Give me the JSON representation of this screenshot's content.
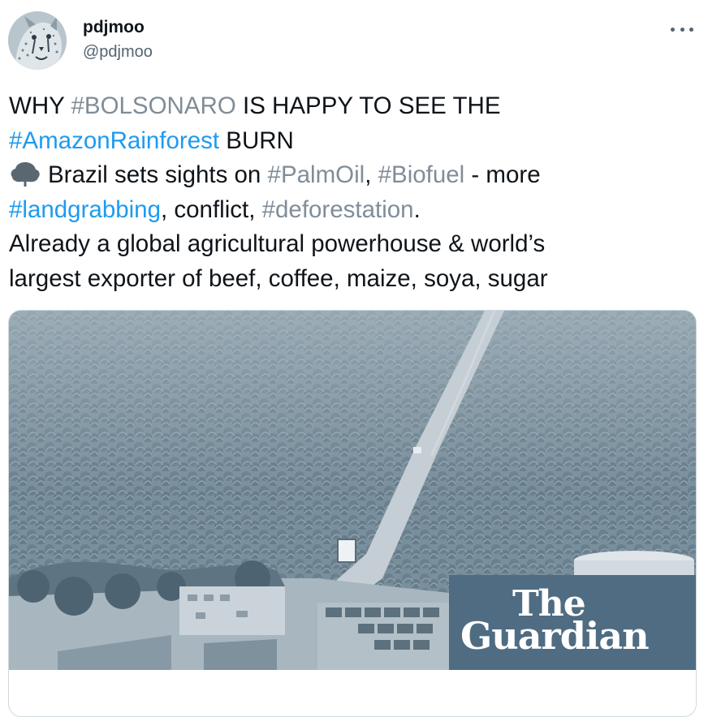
{
  "user": {
    "display_name": "pdjmoo",
    "handle": "@pdjmoo"
  },
  "tweet": {
    "line1": {
      "prefix": "WHY ",
      "hashtag": "#BOLSONARO",
      "suffix": " IS HAPPY TO SEE THE"
    },
    "line2": {
      "hashtag": "#AmazonRainforest",
      "suffix": " BURN"
    },
    "line3": {
      "text": "Brazil sets sights on ",
      "hashtag1": "#PalmOil",
      "sep": ", ",
      "hashtag2": "#Biofuel",
      "suffix": " - more"
    },
    "line4": {
      "hashtag1": "#landgrabbing",
      "mid": ", conflict, ",
      "hashtag2": "#deforestation",
      "suffix": "."
    },
    "line5": "Already a global agricultural powerhouse & world’s",
    "line6": "largest exporter of beef, coffee, maize, soya, sugar"
  },
  "card": {
    "logo_line1": "The",
    "logo_line2": "Guardian"
  },
  "icons": {
    "more": "more-horizontal-icon",
    "tree": "deciduous-tree-icon"
  },
  "colors": {
    "hashtag_blue": "#1d9bf0",
    "hashtag_gray": "#808d98",
    "guardian_panel": "#4f6c82"
  }
}
